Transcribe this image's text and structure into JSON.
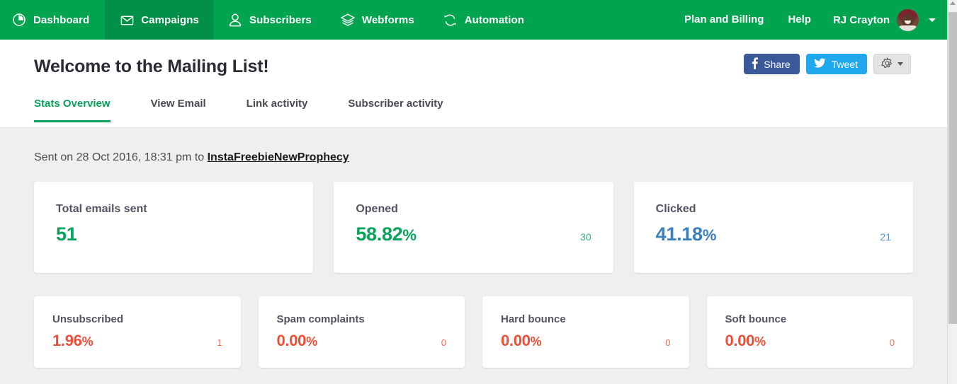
{
  "navbar": {
    "brand_color": "#00a44f",
    "active_bg": "#029048",
    "items": [
      {
        "label": "Dashboard",
        "icon": "pie-clock-icon",
        "active": false
      },
      {
        "label": "Campaigns",
        "icon": "envelope-icon",
        "active": true
      },
      {
        "label": "Subscribers",
        "icon": "user-icon",
        "active": false
      },
      {
        "label": "Webforms",
        "icon": "layers-icon",
        "active": false
      },
      {
        "label": "Automation",
        "icon": "sync-icon",
        "active": false
      }
    ],
    "right_links": [
      {
        "label": "Plan and Billing"
      },
      {
        "label": "Help"
      }
    ],
    "user": {
      "name": "RJ Crayton",
      "avatar": "user-avatar",
      "caret": "chevron-down-icon"
    }
  },
  "header": {
    "title": "Welcome to the Mailing List!",
    "share_button": {
      "label": "Share",
      "icon": "facebook-icon",
      "color": "#3b5998"
    },
    "tweet_button": {
      "label": "Tweet",
      "icon": "twitter-icon",
      "color": "#1fa9ec"
    },
    "settings_button": {
      "icon": "gear-icon",
      "caret": "caret-down-icon"
    }
  },
  "tabs": [
    {
      "label": "Stats Overview",
      "active": true
    },
    {
      "label": "View Email",
      "active": false
    },
    {
      "label": "Link activity",
      "active": false
    },
    {
      "label": "Subscriber activity",
      "active": false
    }
  ],
  "sent_info": {
    "prefix": "Sent on 28 Oct 2016, 18:31 pm to ",
    "list_name": "InstaFreebieNewProphecy"
  },
  "stats": {
    "primary": [
      {
        "label": "Total emails sent",
        "value": "51",
        "percent": "",
        "count": "",
        "color": "#07a35b"
      },
      {
        "label": "Opened",
        "value": "58.82",
        "percent": "%",
        "count": "30",
        "color": "#07a35b"
      },
      {
        "label": "Clicked",
        "value": "41.18",
        "percent": "%",
        "count": "21",
        "color": "#3a7fc0"
      }
    ],
    "secondary": [
      {
        "label": "Unsubscribed",
        "value": "1.96",
        "percent": "%",
        "count": "1",
        "color": "#ec4f37"
      },
      {
        "label": "Spam complaints",
        "value": "0.00",
        "percent": "%",
        "count": "0",
        "color": "#ec4f37"
      },
      {
        "label": "Hard bounce",
        "value": "0.00",
        "percent": "%",
        "count": "0",
        "color": "#ec4f37"
      },
      {
        "label": "Soft bounce",
        "value": "0.00",
        "percent": "%",
        "count": "0",
        "color": "#ec4f37"
      }
    ]
  },
  "scrollbar": {
    "position": "right",
    "thumb": "vertical-scroll-thumb"
  }
}
